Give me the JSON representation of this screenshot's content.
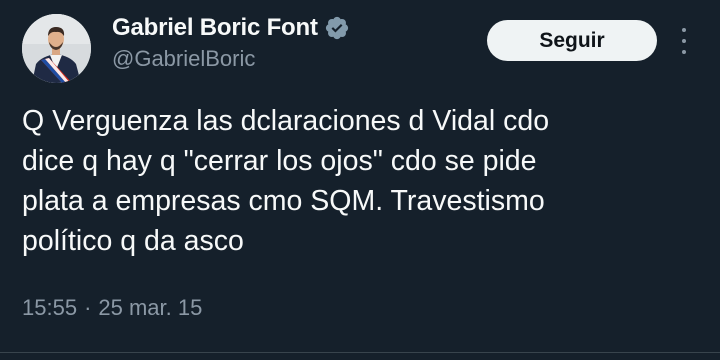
{
  "author": {
    "display_name": "Gabriel Boric Font",
    "handle": "@GabrielBoric",
    "verified_badge_icon": "verified-badge-icon",
    "avatar_icon": "profile-photo"
  },
  "actions": {
    "follow_label": "Seguir",
    "more_icon": "more-options-icon"
  },
  "tweet": {
    "text": "Q Verguenza las dclaraciones d Vidal cdo\ndice q hay q \"cerrar los ojos\" cdo se pide\nplata a empresas cmo SQM. Travestismo\npolítico q da asco",
    "time": "15:55",
    "separator": "·",
    "date": "25 mar. 15"
  },
  "colors": {
    "background": "#15202b",
    "primary_text": "#f7f9f9",
    "secondary_text": "#8b98a5",
    "follow_button_bg": "#eff3f4",
    "follow_button_text": "#0f1419",
    "divider": "#38444d"
  }
}
